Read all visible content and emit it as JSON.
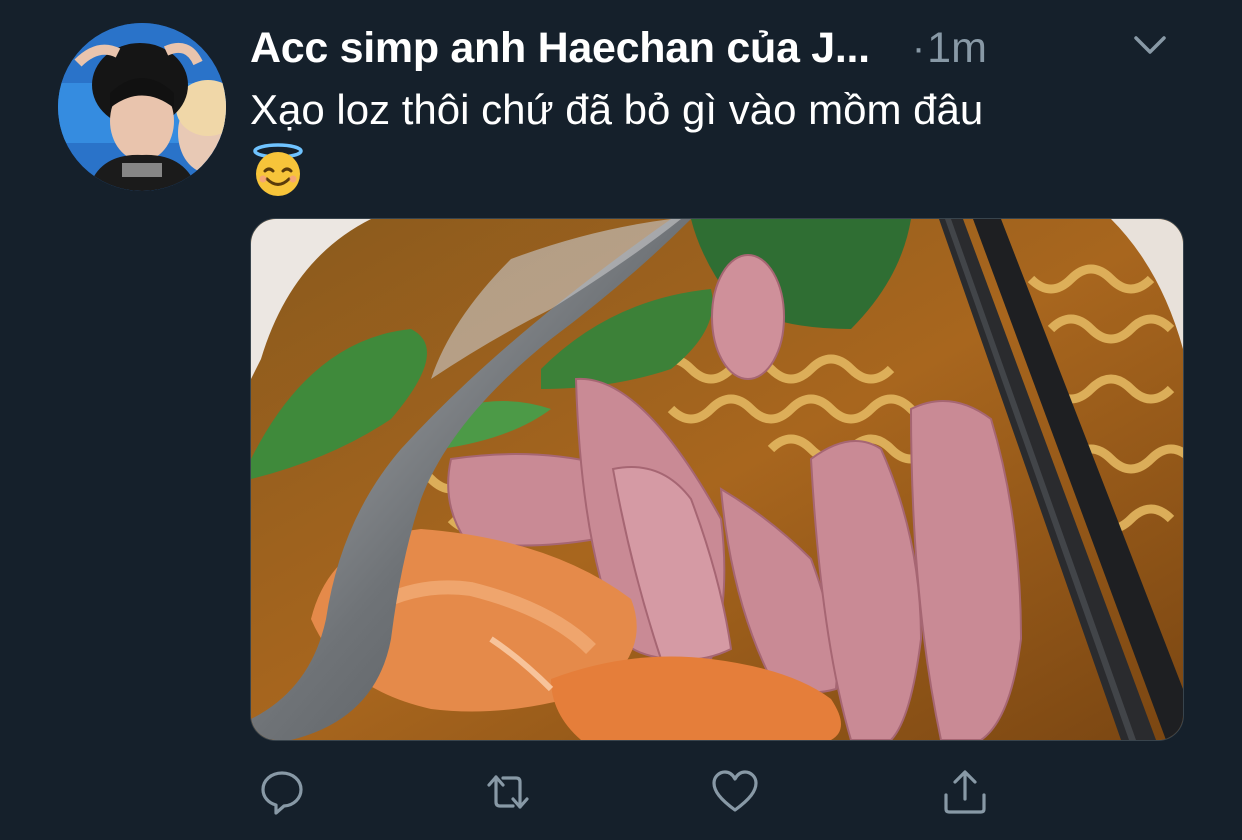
{
  "author": {
    "display_name": "Acc simp anh Haechan của J...",
    "time_separator": "·",
    "timestamp": "1m"
  },
  "tweet": {
    "text": "Xạo loz thôi chứ đã bỏ gì vào mồm đâu",
    "emoji": "smiling-face-with-halo"
  },
  "media": {
    "description_icon": "photo"
  },
  "actions": {
    "reply_icon": "reply-icon",
    "retweet_icon": "retweet-icon",
    "like_icon": "heart-icon",
    "share_icon": "share-icon"
  },
  "colors": {
    "background": "#15202b",
    "text_primary": "#ffffff",
    "text_secondary": "#8899a6"
  }
}
